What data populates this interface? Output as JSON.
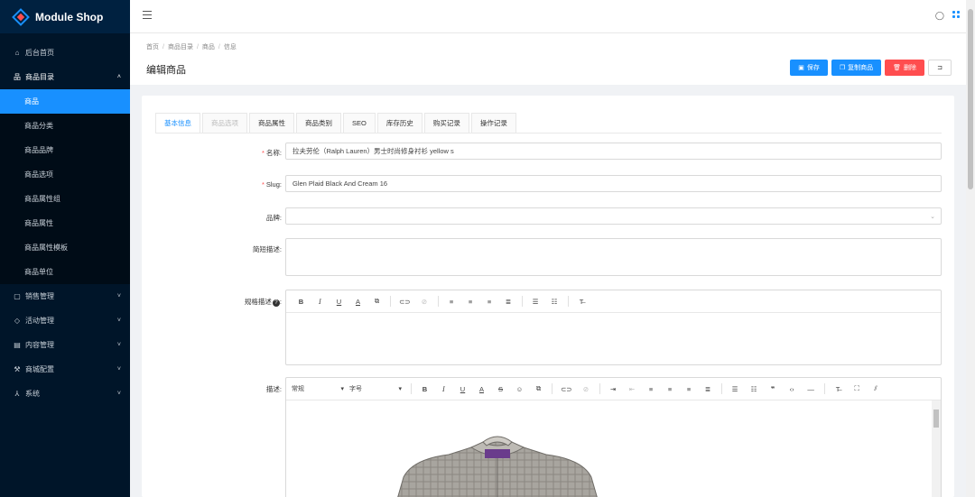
{
  "app": {
    "name": "Module Shop"
  },
  "sidebar": {
    "items": [
      {
        "label": "后台首页",
        "icon": "home-icon"
      },
      {
        "label": "商品目录",
        "icon": "tree-icon",
        "open": true
      },
      {
        "label": "销售管理",
        "icon": "bag-icon"
      },
      {
        "label": "活动管理",
        "icon": "tag-icon"
      },
      {
        "label": "内容管理",
        "icon": "doc-icon"
      },
      {
        "label": "商城配置",
        "icon": "wrench-icon"
      },
      {
        "label": "系统",
        "icon": "cluster-icon"
      }
    ],
    "subitems": [
      "商品",
      "商品分类",
      "商品品牌",
      "商品选项",
      "商品属性组",
      "商品属性",
      "商品属性模板",
      "商品单位"
    ]
  },
  "breadcrumb": [
    "首页",
    "商品目录",
    "商品",
    "信息"
  ],
  "page": {
    "title": "编辑商品"
  },
  "actions": {
    "save": "保存",
    "copy": "复制商品",
    "delete": "删除"
  },
  "tabs": [
    "基本信息",
    "商品选项",
    "商品属性",
    "商品类别",
    "SEO",
    "库存历史",
    "购买记录",
    "操作记录"
  ],
  "form": {
    "name_label": "名称:",
    "name_value": "拉夫劳伦（Ralph Lauren）男士时尚修身衬衫 yellow s",
    "slug_label": "Slug:",
    "slug_value": "Glen Plaid Black And Cream 16",
    "brand_label": "品牌:",
    "short_desc_label": "简短描述:",
    "spec_label": "规格描述",
    "desc_label": "描述:",
    "para_select": "常规",
    "size_select": "字号"
  },
  "colors": {
    "accent": "#1890ff",
    "danger": "#ff4d4f",
    "sidebar": "#001529"
  }
}
